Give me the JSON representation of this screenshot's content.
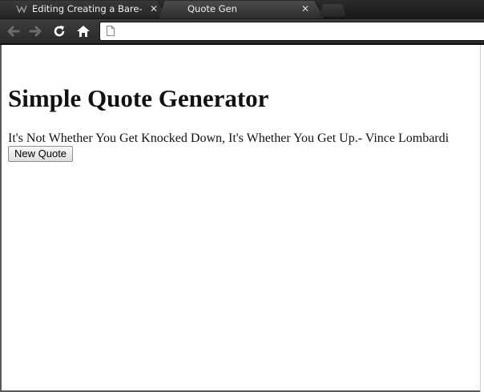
{
  "browser": {
    "tabs": [
      {
        "title": "Editing Creating a Bare-Bo",
        "favicon": "wiki-favicon-icon",
        "active": false
      },
      {
        "title": "Quote Gen",
        "active": true
      }
    ],
    "close_glyph": "✕",
    "nav": {
      "back": "back-arrow-icon",
      "forward": "forward-arrow-icon",
      "reload": "reload-icon",
      "home": "home-icon"
    },
    "address": {
      "value": "",
      "placeholder": ""
    }
  },
  "page": {
    "heading": "Simple Quote Generator",
    "quote": "It's Not Whether You Get Knocked Down, It's Whether You Get Up.- Vince Lombardi",
    "button_label": "New Quote"
  }
}
